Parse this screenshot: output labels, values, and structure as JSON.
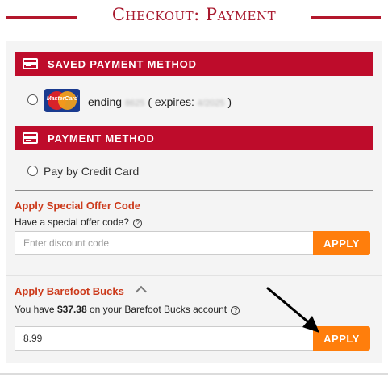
{
  "page": {
    "title": "Checkout: Payment"
  },
  "saved_method": {
    "header": "SAVED PAYMENT METHOD",
    "card": {
      "logo_text": "MasterCard",
      "ending_label": "ending",
      "last4": "8625",
      "expires_label": "( expires:",
      "expiry": "4/2025",
      "close_paren": ")"
    }
  },
  "payment_method": {
    "header": "PAYMENT METHOD",
    "option_label": "Pay by Credit Card"
  },
  "offer": {
    "title": "Apply Special Offer Code",
    "question": "Have a special offer code?",
    "placeholder": "Enter discount code",
    "apply_label": "APPLY"
  },
  "bucks": {
    "title": "Apply Barefoot Bucks",
    "prefix": "You have",
    "amount": "$37.38",
    "suffix": "on your Barefoot Bucks account",
    "input_value": "8.99",
    "apply_label": "APPLY"
  },
  "icons": {
    "help": "question-circle-icon",
    "card": "credit-card-icon",
    "collapse": "chevron-up-icon"
  },
  "colors": {
    "brand_red": "#be0c2b",
    "title_red": "#a8192e",
    "label_orange_red": "#cc3a1b",
    "apply_orange": "#ff7e0c"
  }
}
